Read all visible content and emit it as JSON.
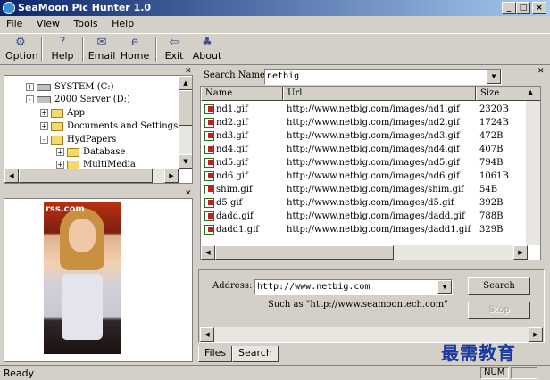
{
  "window": {
    "title": "SeaMoon Pic Hunter 1.0",
    "min": "_",
    "max": "□",
    "close": "×"
  },
  "menu": [
    {
      "label": "File"
    },
    {
      "label": "View"
    },
    {
      "label": "Tools"
    },
    {
      "label": "Help"
    }
  ],
  "toolbar": [
    {
      "label": "Option",
      "icon": "wrench-icon",
      "glyph": "⚙"
    },
    {
      "label": "Help",
      "icon": "help-icon",
      "glyph": "?"
    },
    {
      "label": "Email",
      "icon": "envelope-icon",
      "glyph": "✉"
    },
    {
      "label": "Home",
      "icon": "globe-icon",
      "glyph": "e"
    },
    {
      "label": "Exit",
      "icon": "exit-door-icon",
      "glyph": "⇦"
    },
    {
      "label": "About",
      "icon": "about-icon",
      "glyph": "♣"
    }
  ],
  "tree": {
    "items": [
      {
        "label": "SYSTEM (C:)",
        "toggle": "+"
      },
      {
        "label": "2000 Server (D:)",
        "toggle": "-"
      },
      {
        "label": "App",
        "toggle": "+"
      },
      {
        "label": "Documents and Settings",
        "toggle": "+"
      },
      {
        "label": "HydPapers",
        "toggle": "-"
      },
      {
        "label": "Database",
        "toggle": "+"
      },
      {
        "label": "MultiMedia",
        "toggle": "+"
      }
    ]
  },
  "preview": {
    "logo": "rss.com"
  },
  "search": {
    "label": "Search Name:",
    "value": "netbig"
  },
  "results": {
    "columns": [
      "Name",
      "Url",
      "Size"
    ],
    "rows": [
      {
        "name": "nd1.gif",
        "url": "http://www.netbig.com/images/nd1.gif",
        "size": "2320B"
      },
      {
        "name": "nd2.gif",
        "url": "http://www.netbig.com/images/nd2.gif",
        "size": "1724B"
      },
      {
        "name": "nd3.gif",
        "url": "http://www.netbig.com/images/nd3.gif",
        "size": "472B"
      },
      {
        "name": "nd4.gif",
        "url": "http://www.netbig.com/images/nd4.gif",
        "size": "407B"
      },
      {
        "name": "nd5.gif",
        "url": "http://www.netbig.com/images/nd5.gif",
        "size": "794B"
      },
      {
        "name": "nd6.gif",
        "url": "http://www.netbig.com/images/nd6.gif",
        "size": "1061B"
      },
      {
        "name": "shim.gif",
        "url": "http://www.netbig.com/images/shim.gif",
        "size": "54B"
      },
      {
        "name": "d5.gif",
        "url": "http://www.netbig.com/images/d5.gif",
        "size": "392B"
      },
      {
        "name": "dadd.gif",
        "url": "http://www.netbig.com/images/dadd.gif",
        "size": "788B"
      },
      {
        "name": "dadd1.gif",
        "url": "http://www.netbig.com/images/dadd1.gif",
        "size": "329B"
      }
    ]
  },
  "address": {
    "label": "Address:",
    "value": "http://www.netbig.com",
    "hint": "Such as \"http://www.seamoontech.com\""
  },
  "buttons": {
    "search": "Search",
    "stop": "Stop"
  },
  "tabs": [
    {
      "label": "Files"
    },
    {
      "label": "Search"
    }
  ],
  "status": {
    "text": "Ready",
    "num": "NUM"
  },
  "watermark": "最需教育"
}
